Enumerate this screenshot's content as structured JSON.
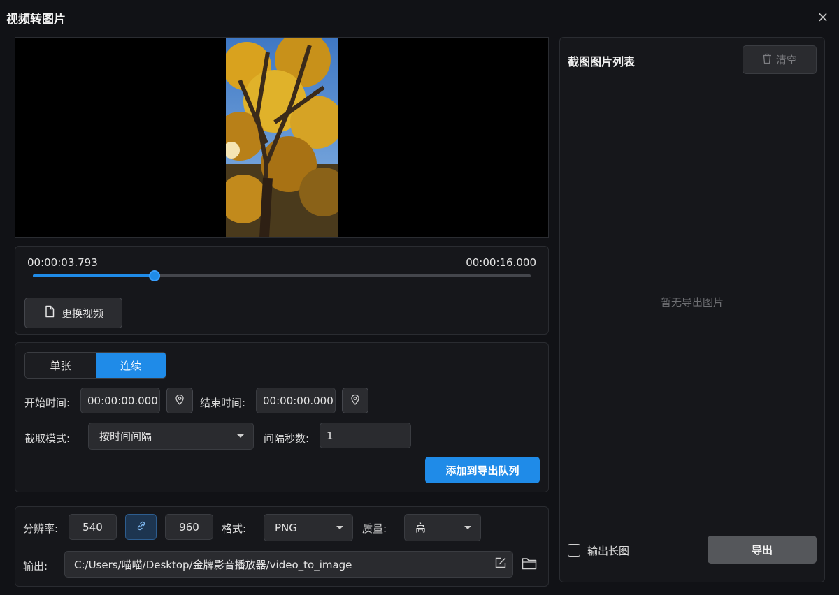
{
  "window": {
    "title": "视频转图片",
    "close_label": "×"
  },
  "player": {
    "current_time": "00:00:03.793",
    "total_time": "00:00:16.000",
    "progress": 0.244,
    "change_video_label": "更换视频"
  },
  "mode_tabs": {
    "single": "单张",
    "continuous": "连续",
    "active": "continuous"
  },
  "range": {
    "start_label": "开始时间:",
    "start_value": "00:00:00.000",
    "end_label": "结束时间:",
    "end_value": "00:00:00.000"
  },
  "capture": {
    "mode_label": "截取模式:",
    "mode_value": "按时间间隔",
    "interval_label": "间隔秒数:",
    "interval_value": "1",
    "add_queue_label": "添加到导出队列"
  },
  "output": {
    "resolution_label": "分辨率:",
    "width": "540",
    "height": "960",
    "format_label": "格式:",
    "format_value": "PNG",
    "quality_label": "质量:",
    "quality_value": "高",
    "path_label": "输出:",
    "path_value": "C:/Users/喵喵/Desktop/金牌影音播放器/video_to_image"
  },
  "sidebar": {
    "title": "截图图片列表",
    "clear_label": "清空",
    "empty_text": "暂无导出图片",
    "long_image_label": "输出长图",
    "export_label": "导出"
  },
  "colors": {
    "accent": "#1f8be8",
    "background": "#111216",
    "panel": "#16171b"
  },
  "icons": [
    "close-icon",
    "file-icon",
    "location-pin-icon",
    "link-icon",
    "edit-icon",
    "folder-icon",
    "trash-icon",
    "chevron-down-icon"
  ]
}
